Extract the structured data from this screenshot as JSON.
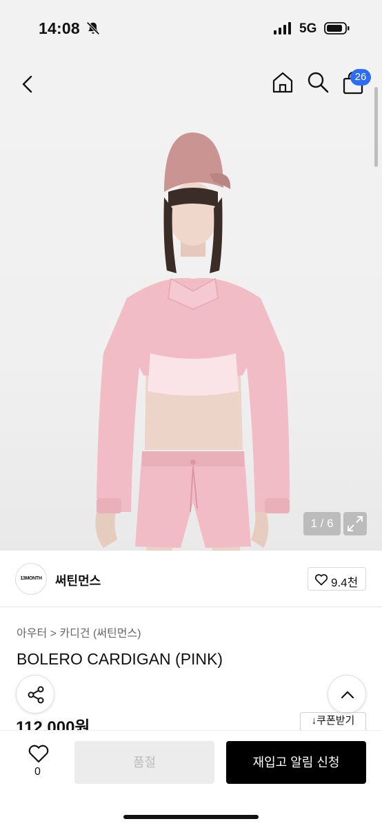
{
  "status_bar": {
    "time": "14:08",
    "network": "5G"
  },
  "nav": {
    "cart_count": "26"
  },
  "gallery": {
    "counter": "1 / 6"
  },
  "brand": {
    "logo_text": "13MONTH",
    "name": "써틴먼스",
    "likes": "9.4천"
  },
  "product": {
    "breadcrumb": "아우터 > 카디건 (써틴먼스)",
    "title": "BOLERO CARDIGAN (PINK)",
    "price": "112,000원",
    "coupon_label": "↓쿠폰받기"
  },
  "bottom": {
    "wish_count": "0",
    "soldout_label": "품절",
    "restock_label": "재입고 알림 신청"
  },
  "colors": {
    "accent_badge": "#2d6cf6",
    "garment_pink": "#f1bcc5",
    "primary_button": "#000000",
    "disabled_button": "#ececec"
  }
}
